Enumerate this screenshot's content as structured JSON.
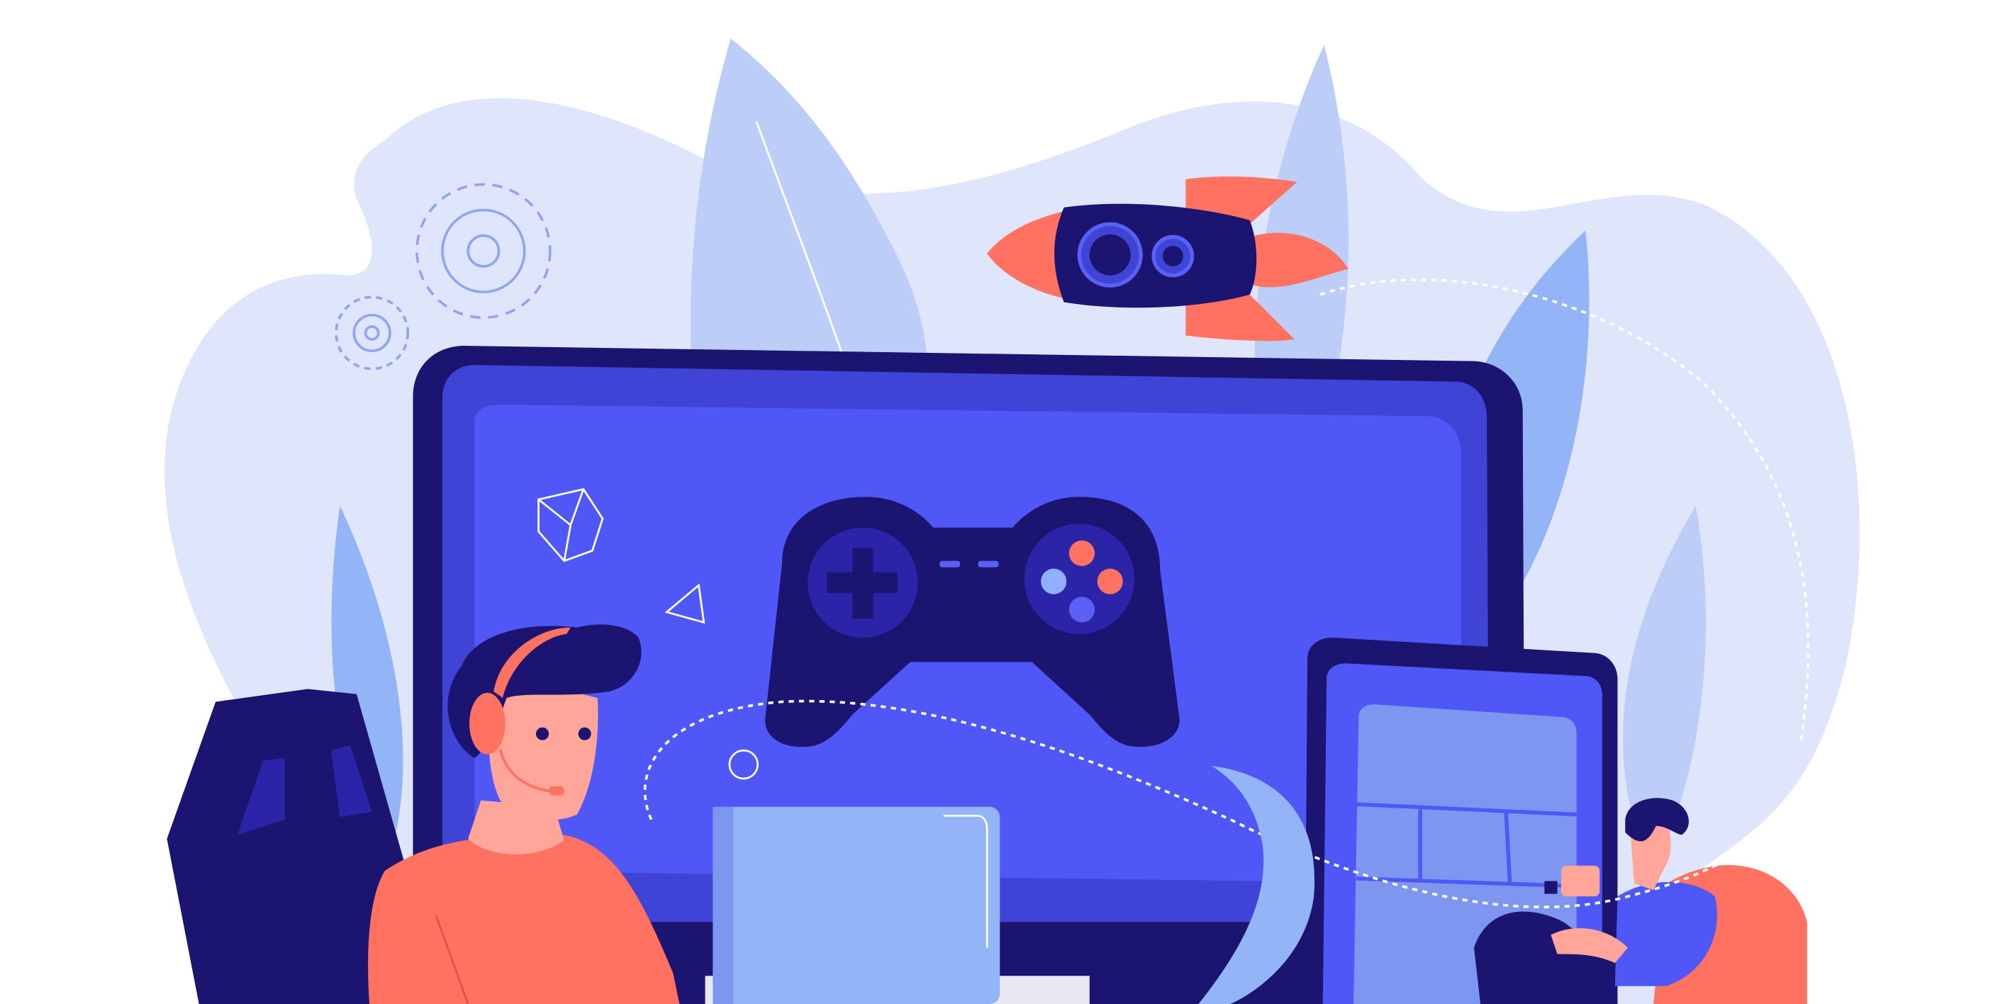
{
  "illustration": {
    "subject": "gaming",
    "colors": {
      "background": "#ffffff",
      "blob": "#dfe6fb",
      "leaf": "#bccdf7",
      "leaf_dark": "#93b4f7",
      "navy": "#1b1470",
      "bezel": "#3f44d6",
      "screen": "#4f57f7",
      "tablet_screen": "#7d97f0",
      "coral": "#ff7160",
      "skin": "#ffa59a",
      "laptop": "#93b4f7",
      "button_red": "#ff7160",
      "button_blue": "#8fb0ff",
      "button_purple": "#5b60f5"
    }
  }
}
